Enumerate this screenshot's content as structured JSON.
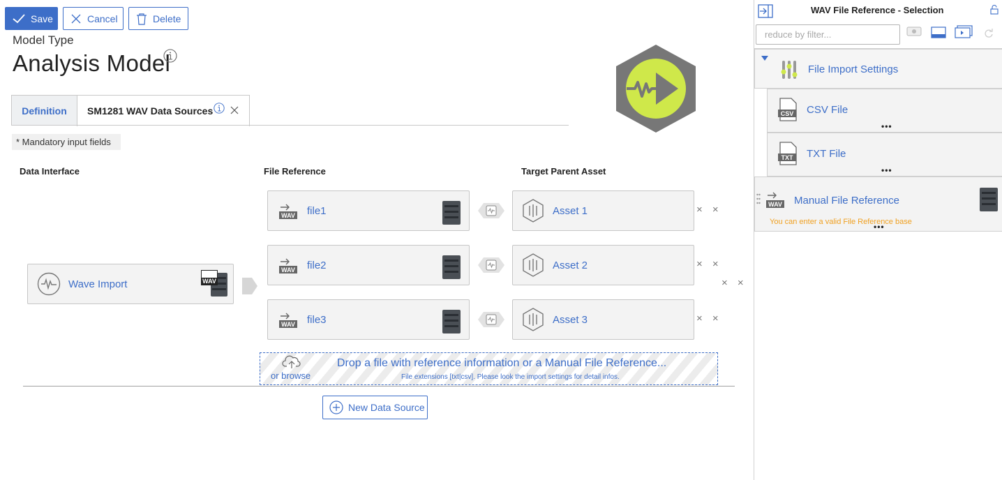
{
  "toolbar": {
    "save_label": "Save",
    "cancel_label": "Cancel",
    "delete_label": "Delete"
  },
  "header": {
    "subtitle": "Model Type",
    "title": "Analysis Model"
  },
  "tabs": [
    {
      "label": "Definition"
    },
    {
      "label": "SM1281 WAV Data Sources"
    }
  ],
  "mandatory_note": "* Mandatory input fields",
  "columns": {
    "data_interface": "Data Interface",
    "file_reference": "File Reference",
    "target_parent_asset": "Target Parent Asset"
  },
  "data_interface": {
    "label": "Wave Import",
    "file_badge": "WAV"
  },
  "file_badge": "WAV",
  "rows": [
    {
      "file": "file1",
      "asset": "Asset 1"
    },
    {
      "file": "file2",
      "asset": "Asset 2"
    },
    {
      "file": "file3",
      "asset": "Asset 3"
    }
  ],
  "remove_glyph": "× ×",
  "drop_zone": {
    "title": "Drop a file with reference information or a Manual File Reference...",
    "subtitle": "File extensions [txt|csv]. Please look the import settings for detail infos.",
    "browse": "or browse"
  },
  "new_data_source_label": "New Data Source",
  "panel": {
    "title": "WAV File Reference - Selection",
    "filter_placeholder": "reduce by filter...",
    "group_label": "File Import Settings",
    "items": [
      {
        "label": "CSV File",
        "badge": "CSV"
      },
      {
        "label": "TXT File",
        "badge": "TXT"
      }
    ],
    "manual": {
      "label": "Manual File Reference",
      "badge": "WAV",
      "hint": "You can enter a valid File Reference base"
    },
    "more_glyph": "•••"
  },
  "colors": {
    "accent": "#3d6ec8",
    "hex_icon_bg": "#777777",
    "hex_icon_fg": "#cfe84a",
    "card_bg": "#f3f3f3",
    "hint": "#f0a020"
  },
  "icons": [
    "check-icon",
    "close-icon",
    "trash-icon",
    "info-icon",
    "waveform-icon",
    "wav-file-icon",
    "device-icon",
    "link-icon",
    "asset-icon",
    "upload-cloud-icon",
    "plus-circle-icon",
    "dock-icon",
    "unlock-icon",
    "slider-icon",
    "csv-file-icon",
    "txt-file-icon"
  ]
}
